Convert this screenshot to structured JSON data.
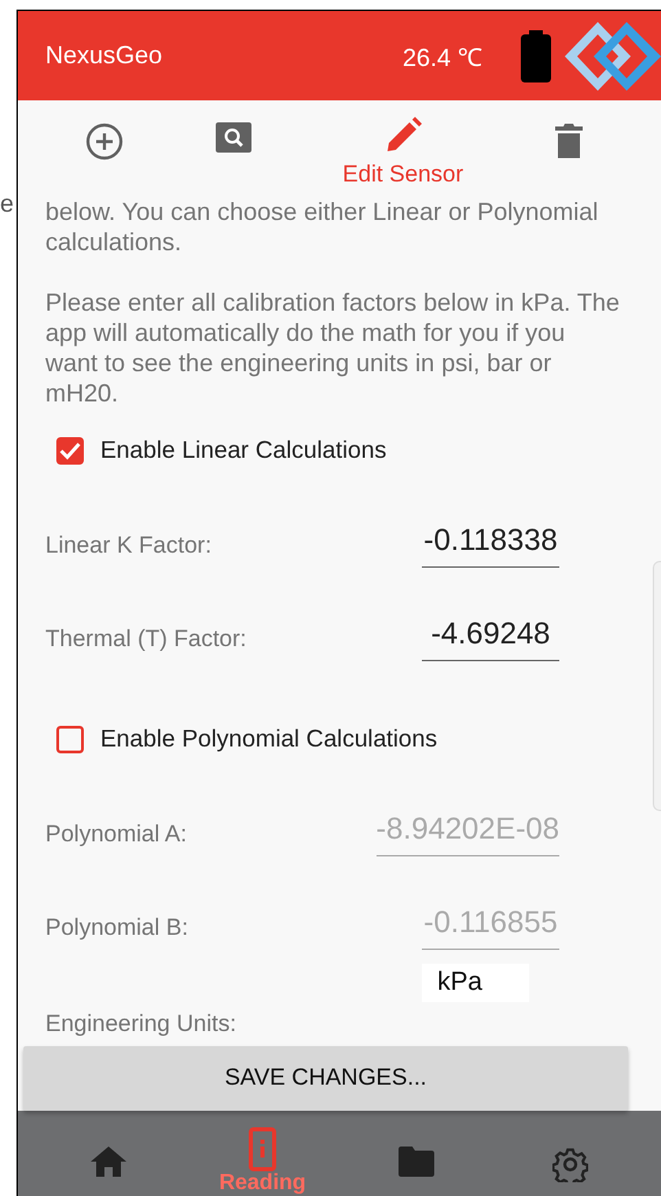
{
  "edge_text": "e",
  "app_bar": {
    "title": "NexusGeo",
    "temperature": "26.4 ℃"
  },
  "toolbar": [
    {
      "kind": "add",
      "selected": false
    },
    {
      "kind": "search",
      "selected": false
    },
    {
      "kind": "edit",
      "label": "Edit Sensor",
      "selected": true
    },
    {
      "kind": "delete",
      "selected": false
    }
  ],
  "paragraphs": [
    "below. You can choose either Linear or Polynomial calculations.",
    "Please enter all calibration factors below in kPa. The app will automatically do the math for you if you want to see the engineering units in psi, bar or mH20."
  ],
  "sections": [
    {
      "checkbox": {
        "label": "Enable Linear Calculations",
        "checked": true
      },
      "fields": [
        {
          "label": "Linear K Factor:",
          "value": "-0.118338",
          "disabled": false
        },
        {
          "label": "Thermal (T) Factor:",
          "value": "-4.69248",
          "disabled": false
        }
      ]
    },
    {
      "checkbox": {
        "label": "Enable Polynomial Calculations",
        "checked": false
      },
      "fields": [
        {
          "label": "Polynomial A:",
          "value": "-8.94202E-08",
          "disabled": true
        },
        {
          "label": "Polynomial B:",
          "value": "-0.116855",
          "disabled": true
        }
      ]
    }
  ],
  "units": {
    "label": "Engineering Units:",
    "value": "kPa"
  },
  "save_button": "SAVE CHANGES...",
  "bottom_nav": [
    {
      "kind": "home",
      "selected": false
    },
    {
      "kind": "reading",
      "label": "Reading",
      "selected": true
    },
    {
      "kind": "folder",
      "selected": false
    },
    {
      "kind": "settings",
      "selected": false
    }
  ]
}
